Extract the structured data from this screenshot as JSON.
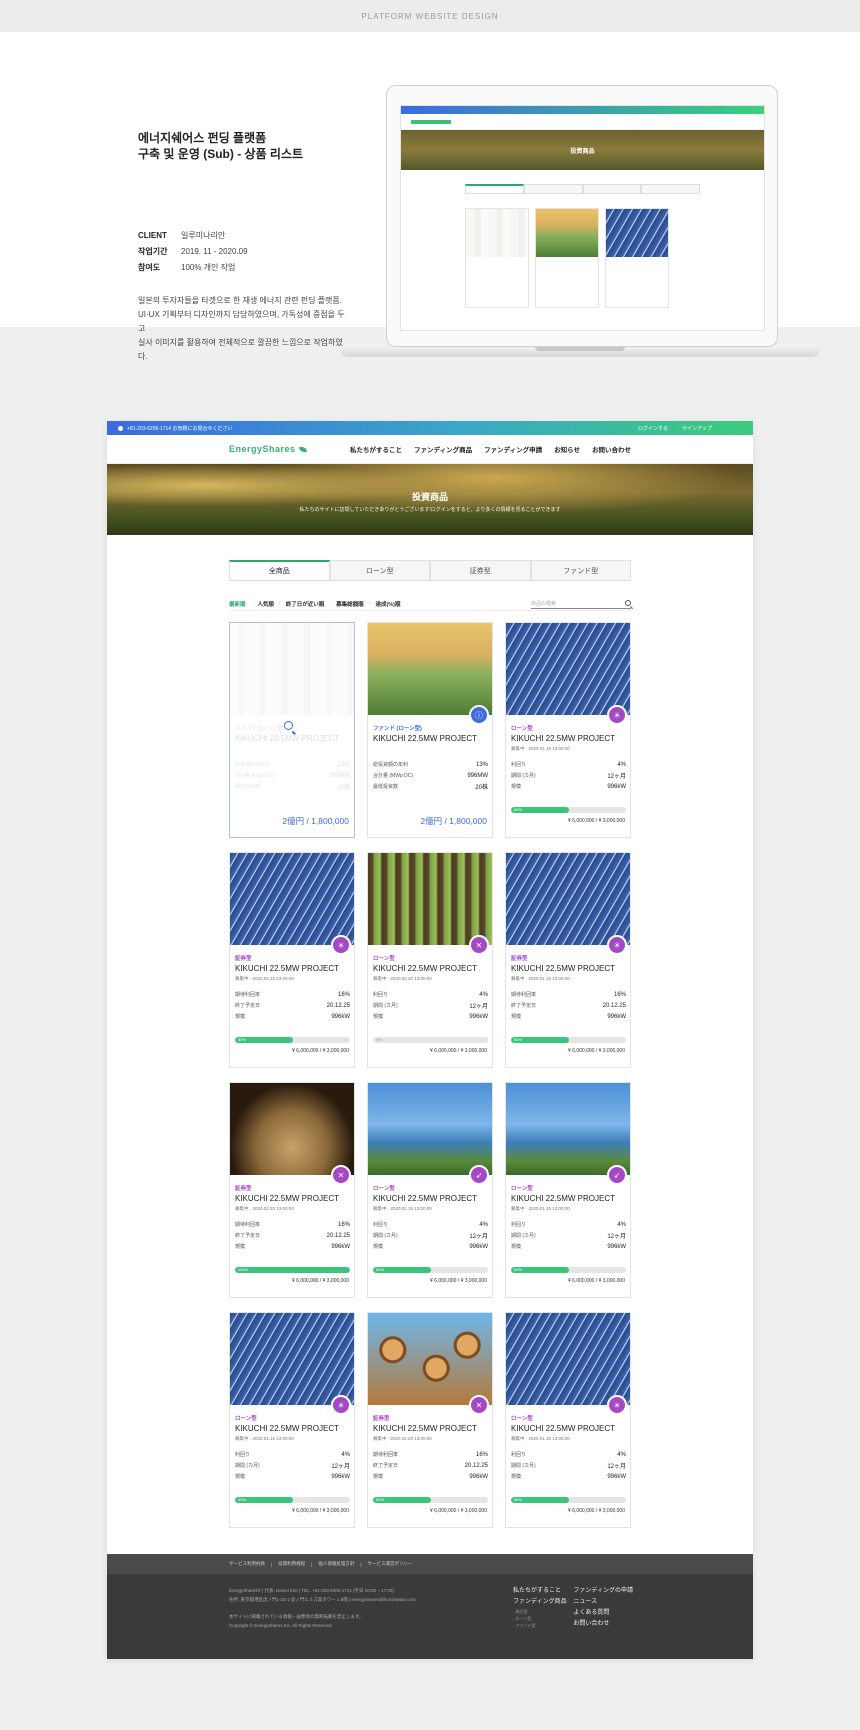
{
  "banner": "PLATFORM WEBSITE DESIGN",
  "intro": {
    "title_line1": "에너지쉐어스 펀딩 플랫폼",
    "title_line2": "구축 및 운영 (Sub) - 상품 리스트",
    "meta": [
      {
        "k": "CLIENT",
        "v": "일루미나리안"
      },
      {
        "k": "작업기간",
        "v": "2019. 11 - 2020.09"
      },
      {
        "k": "참여도",
        "v": "100% 개인 작업"
      }
    ],
    "desc_line1": "일본의 투자자들을 타겟으로 한 재생 에너지 관련 펀딩 플랫폼.",
    "desc_line2": "UI·UX 기획부터 디자인까지 담당하였으며, 가독성에 중점을 두고",
    "desc_line3": "실사 이미지를 활용하여 전체적으로 깔끔한 느낌으로 작업하였다."
  },
  "site": {
    "strip_left": "+81-203-6206-1714 お気軽にお問合せください",
    "login": "ログインする",
    "signup": "サインアップ",
    "logo": "EnergyShares",
    "nav": [
      "私たちがすること",
      "ファンディング商品",
      "ファンディング申請",
      "お知らせ",
      "お問い合わせ"
    ],
    "hero_title": "投資商品",
    "hero_sub": "私たちのサイトに訪問していただきありがとうございます!ログインをすると、より多くの情報を見ることができます",
    "tabs": [
      "全商品",
      "ローン型",
      "証券型",
      "ファンド型"
    ],
    "sorts": [
      "最新順",
      "人気順",
      "終了日が近い順",
      "募集総額順",
      "達成(%)順"
    ],
    "search_placeholder": "商品の検索",
    "cards": [
      {
        "img": "img-birch",
        "faded": true,
        "type": "ファンド (ローン型)",
        "title": "KIKUCHI 22.5MW PROJECT",
        "sub": "",
        "rows": [
          [
            "総投資額の年利",
            "13%"
          ],
          [
            "合計量 (MWp DC)",
            "996MW"
          ],
          [
            "最低投資数",
            "20株"
          ]
        ],
        "price": "2億円 / 1,800,000"
      },
      {
        "img": "img-wind",
        "type": "ファンド (ローン型)",
        "title": "KIKUCHI 22.5MW PROJECT",
        "sub": "",
        "rows": [
          [
            "総投資額の年利",
            "13%"
          ],
          [
            "合計量 (MWp DC)",
            "996MW"
          ],
          [
            "最低投資数",
            "20株"
          ]
        ],
        "price": "2億円 / 1,800,000",
        "color": "#3d6be0"
      },
      {
        "img": "img-solar",
        "type": "ローン型",
        "title": "KIKUCHI 22.5MW PROJECT",
        "sub": "募集中 · 2020.01.15 13:00:00",
        "rows": [
          [
            "利回り",
            "4%"
          ],
          [
            "期間 (カ月)",
            "12ヶ月"
          ],
          [
            "規模",
            "996kW"
          ]
        ],
        "pct": "50%",
        "fill": 50,
        "amt": "¥ 6,000,000 / ¥ 3,000,000"
      },
      {
        "img": "img-solar",
        "type": "証券型",
        "title": "KIKUCHI 22.5MW PROJECT",
        "sub": "募集中 · 2020.01.15 13:00:00",
        "rows": [
          [
            "期待利回率",
            "16%"
          ],
          [
            "終了予定日",
            "20.12.25"
          ],
          [
            "規模",
            "996kW"
          ]
        ],
        "pct": "50%",
        "fill": 50,
        "amt": "¥ 6,000,000 / ¥ 3,000,000"
      },
      {
        "img": "img-forest",
        "type": "ローン型",
        "title": "KIKUCHI 22.5MW PROJECT",
        "sub": "募集中 · 2020.02.20 13:00:00",
        "rows": [
          [
            "利回り",
            "4%"
          ],
          [
            "期間 (カ月)",
            "12ヶ月"
          ],
          [
            "規模",
            "996kW"
          ]
        ],
        "pct": "0%",
        "fill": 0,
        "amt": "¥ 6,000,000 / ¥ 3,000,000"
      },
      {
        "img": "img-solar",
        "type": "証券型",
        "title": "KIKUCHI 22.5MW PROJECT",
        "sub": "募集中 · 2020.01.15 13:00:00",
        "rows": [
          [
            "期待利回率",
            "16%"
          ],
          [
            "終了予定日",
            "20.12.25"
          ],
          [
            "規模",
            "996kW"
          ]
        ],
        "pct": "50%",
        "fill": 50,
        "amt": "¥ 6,000,000 / ¥ 3,000,000"
      },
      {
        "img": "img-pellet",
        "type": "証券型",
        "title": "KIKUCHI 22.5MW PROJECT",
        "sub": "募集中 · 2020.02.20 13:00:00",
        "rows": [
          [
            "期待利回率",
            "16%"
          ],
          [
            "終了予定日",
            "20.12.25"
          ],
          [
            "規模",
            "996kW"
          ]
        ],
        "pct": "100%",
        "fill": 100,
        "amt": "¥ 6,000,000 / ¥ 3,000,000"
      },
      {
        "img": "img-turbine",
        "type": "ローン型",
        "title": "KIKUCHI 22.5MW PROJECT",
        "sub": "募集中 · 2020.01.15 13:00:00",
        "rows": [
          [
            "利回り",
            "4%"
          ],
          [
            "期間 (カ月)",
            "12ヶ月"
          ],
          [
            "規模",
            "996kW"
          ]
        ],
        "pct": "50%",
        "fill": 50,
        "amt": "¥ 6,000,000 / ¥ 3,000,000"
      },
      {
        "img": "img-turbine",
        "type": "ローン型",
        "title": "KIKUCHI 22.5MW PROJECT",
        "sub": "募集中 · 2020.01.15 13:00:00",
        "rows": [
          [
            "利回り",
            "4%"
          ],
          [
            "期間 (カ月)",
            "12ヶ月"
          ],
          [
            "規模",
            "996kW"
          ]
        ],
        "pct": "50%",
        "fill": 50,
        "amt": "¥ 6,000,000 / ¥ 3,000,000"
      },
      {
        "img": "img-solar",
        "type": "ローン型",
        "title": "KIKUCHI 22.5MW PROJECT",
        "sub": "募集中 · 2020.01.15 13:00:00",
        "rows": [
          [
            "利回り",
            "4%"
          ],
          [
            "期間 (カ月)",
            "12ヶ月"
          ],
          [
            "規模",
            "996kW"
          ]
        ],
        "pct": "50%",
        "fill": 50,
        "amt": "¥ 6,000,000 / ¥ 3,000,000"
      },
      {
        "img": "img-logs",
        "type": "証券型",
        "title": "KIKUCHI 22.5MW PROJECT",
        "sub": "募集中 · 2020.02.20 13:00:00",
        "rows": [
          [
            "期待利回率",
            "16%"
          ],
          [
            "終了予定日",
            "20.12.25"
          ],
          [
            "規模",
            "996kW"
          ]
        ],
        "pct": "50%",
        "fill": 50,
        "amt": "¥ 6,000,000 / ¥ 3,000,000"
      },
      {
        "img": "img-solar",
        "type": "ローン型",
        "title": "KIKUCHI 22.5MW PROJECT",
        "sub": "募集中 · 2020.01.15 13:00:00",
        "rows": [
          [
            "利回り",
            "4%"
          ],
          [
            "期間 (カ月)",
            "12ヶ月"
          ],
          [
            "規模",
            "996kW"
          ]
        ],
        "pct": "50%",
        "fill": 50,
        "amt": "¥ 6,000,000 / ¥ 3,000,000"
      }
    ],
    "footer_links": [
      "サービス利用約款",
      "投資利用規程",
      "個人情報処理方針",
      "サービス運営ポリシー"
    ],
    "footer_info1": "EnergyShares®  |  代表: Daniel Kim  |  TEL: +81-203-6206-1714 (平日 10:00 ~ 17:00)",
    "footer_info2": "住所: 東京都港区虎ノ門1-23-1  虎ノ門ヒルズ森タワー 1 8階  |  energyshares@illuminarian.com",
    "footer_info3": "本サイトに掲載されている情報・画像等の無断転載を禁止します。",
    "footer_copy": "Copyright © EnergyShares Inc. All Rights Reserved",
    "footer_col1": [
      "私たちがすること",
      "ファンディング商品"
    ],
    "footer_col1_sub": [
      "- 株式型",
      "- ローン型",
      "- ファンド型"
    ],
    "footer_col2": [
      "ファンディングの申請",
      "ニュース",
      "よくある質問",
      "お問い合わせ"
    ]
  }
}
